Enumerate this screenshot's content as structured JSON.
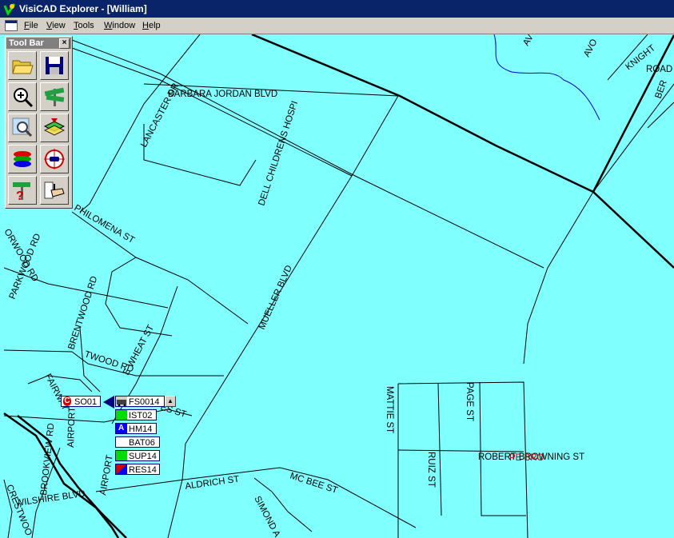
{
  "window": {
    "title": "VisiCAD Explorer - [William]"
  },
  "menu": {
    "items": [
      {
        "u": "F",
        "rest": "ile"
      },
      {
        "u": "V",
        "rest": "iew"
      },
      {
        "u": "T",
        "rest": "ools"
      },
      {
        "u": "W",
        "rest": "indow"
      },
      {
        "u": "H",
        "rest": "elp"
      }
    ]
  },
  "toolbox": {
    "title": "Tool Bar",
    "close": "×",
    "tools": [
      "open-folder-icon",
      "save-disk-icon",
      "zoom-in-icon",
      "street-sign-icon",
      "magnify-map-icon",
      "map-layers-select-icon",
      "layers-icon",
      "vehicle-target-icon",
      "help-sign-icon",
      "hand-pointer-icon"
    ]
  },
  "map": {
    "colors": {
      "background": "#80ffff",
      "streets": "#000000",
      "river": "#0000cc"
    },
    "street_labels": [
      "BARBARA JORDAN BLVD",
      "LANCASTER DR",
      "DELL CHILDRENS HOSPI",
      "PHILOMENA ST",
      "ORWOOD RD",
      "PARKWOOD RD",
      "MUELLER BLVD",
      "BRENTWOOD RD",
      "TWOOD RD",
      "E WHEAT ST",
      "FAIRWAY",
      "AIRPORT",
      "BROOKVIEW RD",
      "AIRPORT",
      "WILSHIRE BLVD",
      "CRESTWOO",
      "ALDRICH ST",
      "MC BEE ST",
      "SIMOND A",
      "MATTIE ST",
      "PAGE ST",
      "RUIZ ST",
      "ROBERT BROWNING ST",
      "AV",
      "AVO",
      "KNIGHT",
      "ROAD",
      "BER",
      "ES ST"
    ],
    "red_label": "PE BRO",
    "units": {
      "so": {
        "badge": "C",
        "name": "SO01"
      },
      "stack": [
        {
          "name": "FS0014",
          "color": "#d4d0c8"
        },
        {
          "name": "IST02",
          "color": "#00dd00"
        },
        {
          "name": "HM14",
          "color": "#0000ff",
          "letter": "A"
        },
        {
          "name": "BAT06",
          "color": "#ffffff"
        },
        {
          "name": "SUP14",
          "color": "#00dd00"
        },
        {
          "name": "RES14",
          "color": "#d00000"
        }
      ]
    }
  }
}
